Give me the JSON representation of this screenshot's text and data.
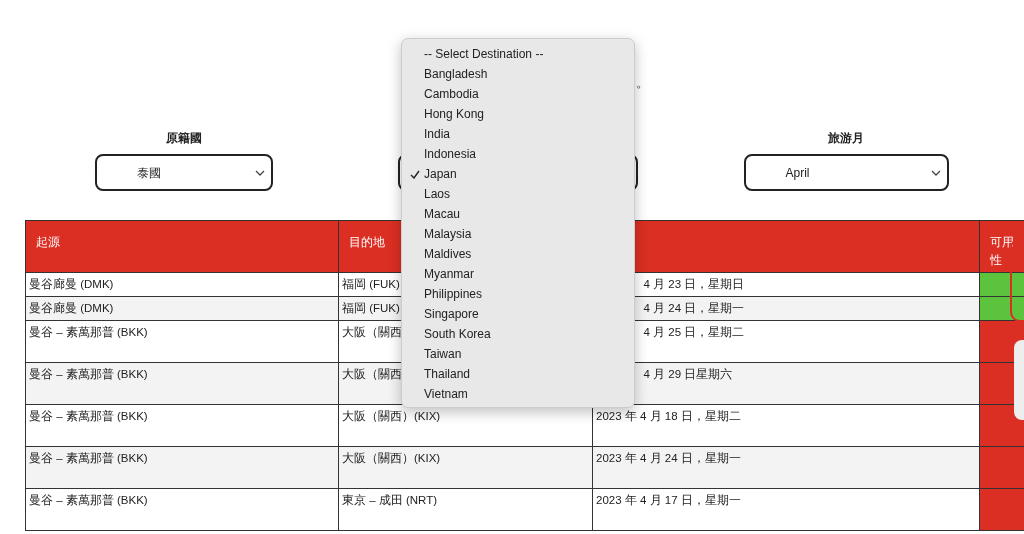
{
  "heading_tail": "。",
  "filters": [
    {
      "label": "原籍國",
      "value": "泰國"
    },
    {
      "expanded": true
    },
    {
      "label": "旅游月",
      "value": "April"
    }
  ],
  "destination_menu": {
    "items": [
      {
        "label": "-- Select Destination --",
        "selected": false
      },
      {
        "label": "Bangladesh",
        "selected": false
      },
      {
        "label": "Cambodia",
        "selected": false
      },
      {
        "label": "Hong Kong",
        "selected": false
      },
      {
        "label": "India",
        "selected": false
      },
      {
        "label": "Indonesia",
        "selected": false
      },
      {
        "label": "Japan",
        "selected": true
      },
      {
        "label": "Laos",
        "selected": false
      },
      {
        "label": "Macau",
        "selected": false
      },
      {
        "label": "Malaysia",
        "selected": false
      },
      {
        "label": "Maldives",
        "selected": false
      },
      {
        "label": "Myanmar",
        "selected": false
      },
      {
        "label": "Philippines",
        "selected": false
      },
      {
        "label": "Singapore",
        "selected": false
      },
      {
        "label": "South Korea",
        "selected": false
      },
      {
        "label": "Taiwan",
        "selected": false
      },
      {
        "label": "Thailand",
        "selected": false
      },
      {
        "label": "Vietnam",
        "selected": false
      }
    ]
  },
  "table": {
    "columns": [
      "起源",
      "目的地",
      "",
      "可用性"
    ],
    "rows": [
      {
        "origin": "曼谷廊曼 (DMK)",
        "destination": "福岡 (FUK)",
        "date": "4 月 23 日，星期日",
        "available": true
      },
      {
        "origin": "曼谷廊曼 (DMK)",
        "destination": "福岡 (FUK)",
        "date": "4 月 24 日，星期一",
        "available": true
      },
      {
        "origin": "曼谷 – 素萬那普 (BKK)",
        "destination": "大阪（關西",
        "date": "4 月 25 日，星期二",
        "available": false
      },
      {
        "origin": "曼谷 – 素萬那普 (BKK)",
        "destination": "大阪（關西",
        "date": "4 月 29 日星期六",
        "available": false
      },
      {
        "origin": "曼谷 – 素萬那普 (BKK)",
        "destination": "大阪（關西）(KIX)",
        "date": "2023 年 4 月 18 日，星期二",
        "available": false
      },
      {
        "origin": "曼谷 – 素萬那普 (BKK)",
        "destination": "大阪（關西）(KIX)",
        "date": "2023 年 4 月 24 日，星期一",
        "available": false
      },
      {
        "origin": "曼谷 – 素萬那普 (BKK)",
        "destination": "東京 – 成田 (NRT)",
        "date": "2023 年 4 月 17 日，星期一",
        "available": false
      }
    ]
  }
}
